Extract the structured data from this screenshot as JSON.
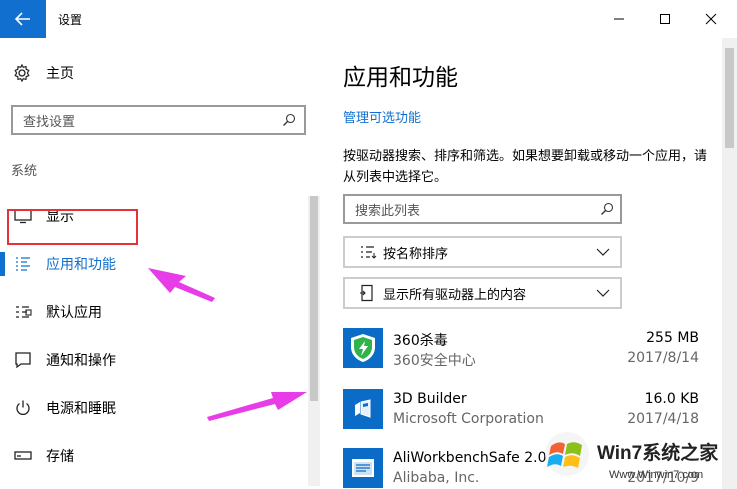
{
  "window": {
    "title": "设置"
  },
  "sidebar": {
    "home_label": "主页",
    "search_placeholder": "查找设置",
    "section_label": "系统",
    "items": [
      {
        "label": "显示",
        "icon": "monitor-icon"
      },
      {
        "label": "应用和功能",
        "icon": "apps-list-icon",
        "selected": true
      },
      {
        "label": "默认应用",
        "icon": "default-apps-icon"
      },
      {
        "label": "通知和操作",
        "icon": "notification-icon"
      },
      {
        "label": "电源和睡眠",
        "icon": "power-icon"
      },
      {
        "label": "存储",
        "icon": "storage-icon"
      }
    ]
  },
  "main": {
    "title": "应用和功能",
    "manage_link": "管理可选功能",
    "description": "按驱动器搜索、排序和筛选。如果想要卸载或移动一个应用，请从列表中选择它。",
    "search_placeholder": "搜索此列表",
    "sort_label": "按名称排序",
    "filter_label": "显示所有驱动器上的内容",
    "apps": [
      {
        "name": "360杀毒",
        "publisher": "360安全中心",
        "size": "255 MB",
        "date": "2017/8/14"
      },
      {
        "name": "3D Builder",
        "publisher": "Microsoft Corporation",
        "size": "16.0 KB",
        "date": "2017/4/18"
      },
      {
        "name": "AliWorkbenchSafe 2.0",
        "publisher": "Alibaba, Inc.",
        "size": "",
        "date": "2017/10/9"
      }
    ]
  },
  "watermark": {
    "brand": "Win7系统之家",
    "url": "Www.Winwin7.com"
  },
  "colors": {
    "accent": "#1170cf",
    "highlight_box": "#e53238",
    "arrow": "#e83ce8"
  }
}
